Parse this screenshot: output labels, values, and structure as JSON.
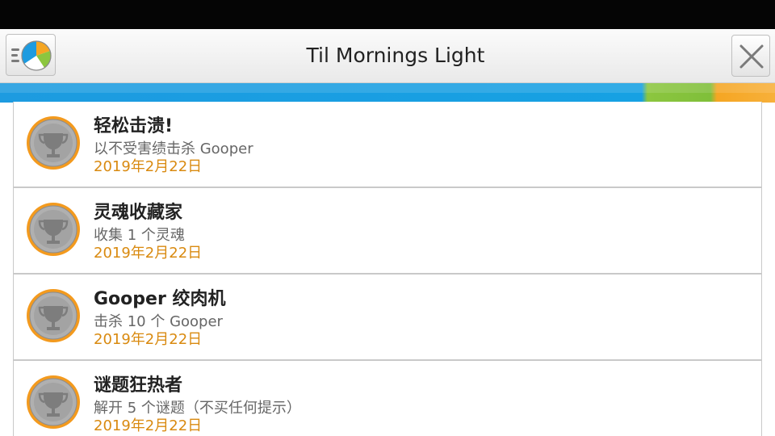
{
  "header": {
    "title": "Til Mornings Light",
    "menu_icon": "menu-logo-icon",
    "close_icon": "close-icon"
  },
  "colors": {
    "accent_blue": "#16a1e3",
    "accent_green": "#8cc63f",
    "accent_orange": "#f5a623",
    "date_text": "#d98a10"
  },
  "achievements": [
    {
      "title": "轻松击溃!",
      "description": "以不受害绩击杀 Gooper",
      "date": "2019年2月22日",
      "icon": "trophy-icon"
    },
    {
      "title": "灵魂收藏家",
      "description": "收集 1 个灵魂",
      "date": "2019年2月22日",
      "icon": "trophy-icon"
    },
    {
      "title": "Gooper 绞肉机",
      "description": "击杀 10 个 Gooper",
      "date": "2019年2月22日",
      "icon": "trophy-icon"
    },
    {
      "title": "谜题狂热者",
      "description": "解开 5 个谜题（不买任何提示）",
      "date": "2019年2月22日",
      "icon": "trophy-icon"
    }
  ]
}
